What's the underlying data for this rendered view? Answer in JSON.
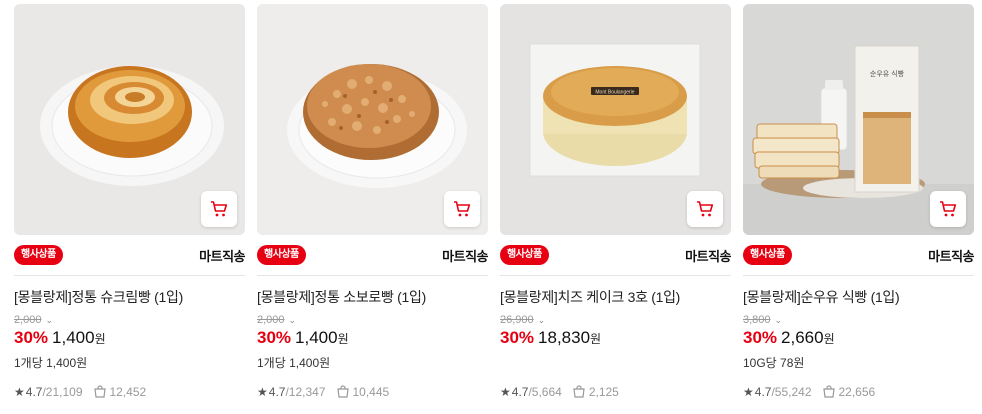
{
  "products": [
    {
      "name": "[몽블랑제]정통 슈크림빵 (1입)",
      "badge": "행사상품",
      "shipping": "마트직송",
      "original_price": "2,000",
      "discount": "30%",
      "price": "1,400",
      "currency": "원",
      "unit_price": "1개당 1,400원",
      "rating": "4.7",
      "review_count": "21,109",
      "purchase_count": "12,452"
    },
    {
      "name": "[몽블랑제]정통 소보로빵 (1입)",
      "badge": "행사상품",
      "shipping": "마트직송",
      "original_price": "2,000",
      "discount": "30%",
      "price": "1,400",
      "currency": "원",
      "unit_price": "1개당 1,400원",
      "rating": "4.7",
      "review_count": "12,347",
      "purchase_count": "10,445"
    },
    {
      "name": "[몽블랑제]치즈 케이크 3호 (1입)",
      "badge": "행사상품",
      "shipping": "마트직송",
      "original_price": "26,900",
      "discount": "30%",
      "price": "18,830",
      "currency": "원",
      "unit_price": "",
      "rating": "4.7",
      "review_count": "5,664",
      "purchase_count": "2,125"
    },
    {
      "name": "[몽블랑제]순우유 식빵 (1입)",
      "badge": "행사상품",
      "shipping": "마트직송",
      "original_price": "3,800",
      "discount": "30%",
      "price": "2,660",
      "currency": "원",
      "unit_price": "10G당 78원",
      "rating": "4.7",
      "review_count": "55,242",
      "purchase_count": "22,656"
    }
  ],
  "cake_label": "Mont Boulangerie",
  "milk_bag_label": "순우유 식빵",
  "icons": {
    "cart": "cart-icon",
    "star": "star-icon",
    "purchase": "shopping-bag-icon",
    "caret": "chevron-down-icon"
  },
  "colors": {
    "accent": "#e60012",
    "badge_bg": "#e60012",
    "muted": "#999999"
  }
}
